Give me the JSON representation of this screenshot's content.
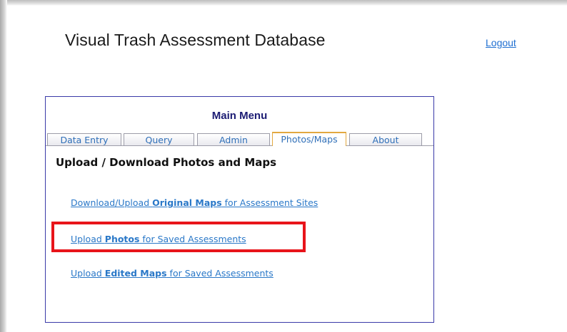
{
  "app": {
    "title": "Visual Trash Assessment Database",
    "logout_label": "Logout"
  },
  "menu": {
    "title": "Main Menu",
    "tabs": [
      {
        "label": "Data Entry",
        "active": false
      },
      {
        "label": "Query",
        "active": false
      },
      {
        "label": "Admin",
        "active": false
      },
      {
        "label": "Photos/Maps",
        "active": true
      },
      {
        "label": "About",
        "active": false
      }
    ],
    "section_heading": "Upload / Download Photos and Maps",
    "links": [
      {
        "prefix": "Download/Upload ",
        "bold": "Original Maps",
        "suffix": " for Assessment Sites"
      },
      {
        "prefix": "Upload ",
        "bold": "Photos",
        "suffix": " for Saved Assessments"
      },
      {
        "prefix": "Upload ",
        "bold": "Edited Maps",
        "suffix": " for Saved Assessments"
      }
    ]
  },
  "colors": {
    "link": "#2a78c8",
    "panel_border": "#3a3aa8",
    "active_tab_border": "#e2a840",
    "highlight": "#e8141a"
  }
}
